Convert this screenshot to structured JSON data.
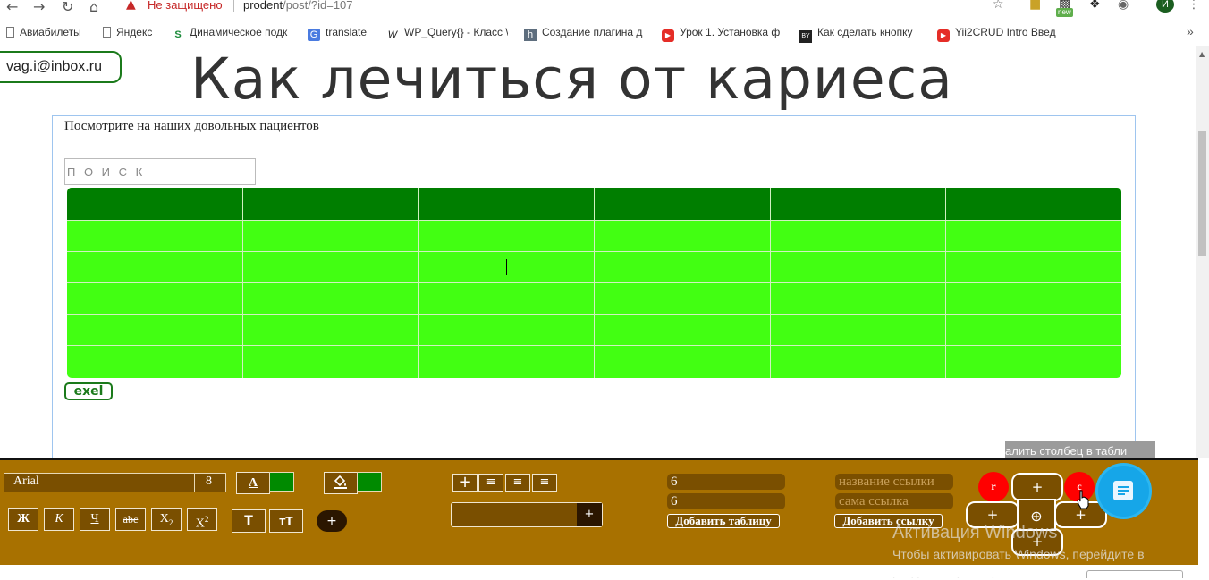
{
  "browser": {
    "security_label": "Не защищено",
    "url_host": "prodent",
    "url_path": "/post/?id=107",
    "new_badge": "new",
    "profile_initial": "И",
    "bookmarks": [
      {
        "label": "Авиабилеты",
        "icon": "page-icon"
      },
      {
        "label": "Яндекс",
        "icon": "page-icon"
      },
      {
        "label": "Динамическое подк",
        "icon": "s-logo-icon"
      },
      {
        "label": "translate",
        "icon": "translate-icon"
      },
      {
        "label": "WP_Query{} - Класс \\",
        "icon": "wp-icon"
      },
      {
        "label": "Создание плагина д",
        "icon": "h-logo-icon"
      },
      {
        "label": "Урок 1. Установка ф",
        "icon": "youtube-icon"
      },
      {
        "label": "Как сделать кнопку",
        "icon": "htmlbook-icon"
      },
      {
        "label": "Yii2CRUD Intro Введ",
        "icon": "youtube-icon"
      }
    ]
  },
  "header": {
    "email": "vag.i@inbox.ru",
    "title": "Как лечиться от кариеса"
  },
  "editor": {
    "subtitle": "Посмотрите на наших довольных пациентов",
    "search_placeholder": "П О И С К",
    "table": {
      "columns": 6,
      "rows": 6,
      "header_color": "#007e00",
      "body_color": "#42ff12"
    },
    "export_button": "exel"
  },
  "toolbar": {
    "font_family": "Arial",
    "font_size": "8",
    "text_color_icon": "A",
    "fill_icon": "paint-bucket-icon",
    "swatch_color": "#008a00",
    "format_buttons": [
      "Ж",
      "К",
      "Ч",
      "abc",
      "X2",
      "X2"
    ],
    "case_buttons": [
      "Т",
      "тТ"
    ],
    "round_plus": "+",
    "align_buttons": [
      "+",
      "≡",
      "≡",
      "≡"
    ],
    "combo_plus": "+",
    "rows_value": "6",
    "cols_value": "6",
    "add_table": "Добавить таблицу",
    "link_name_placeholder": "название ссылки",
    "link_url_placeholder": "сама ссылка",
    "add_link": "Добавить ссылку",
    "red_r": "r",
    "red_c": "c",
    "cross_plus": "+",
    "cross_center": "⊕",
    "tooltip": "алить столбец в табли"
  },
  "os_watermark": {
    "line1": "Активация Windows",
    "line2": "Чтобы активировать Windows, перейдите в",
    "line3": "раздел \"Параметры\"."
  }
}
